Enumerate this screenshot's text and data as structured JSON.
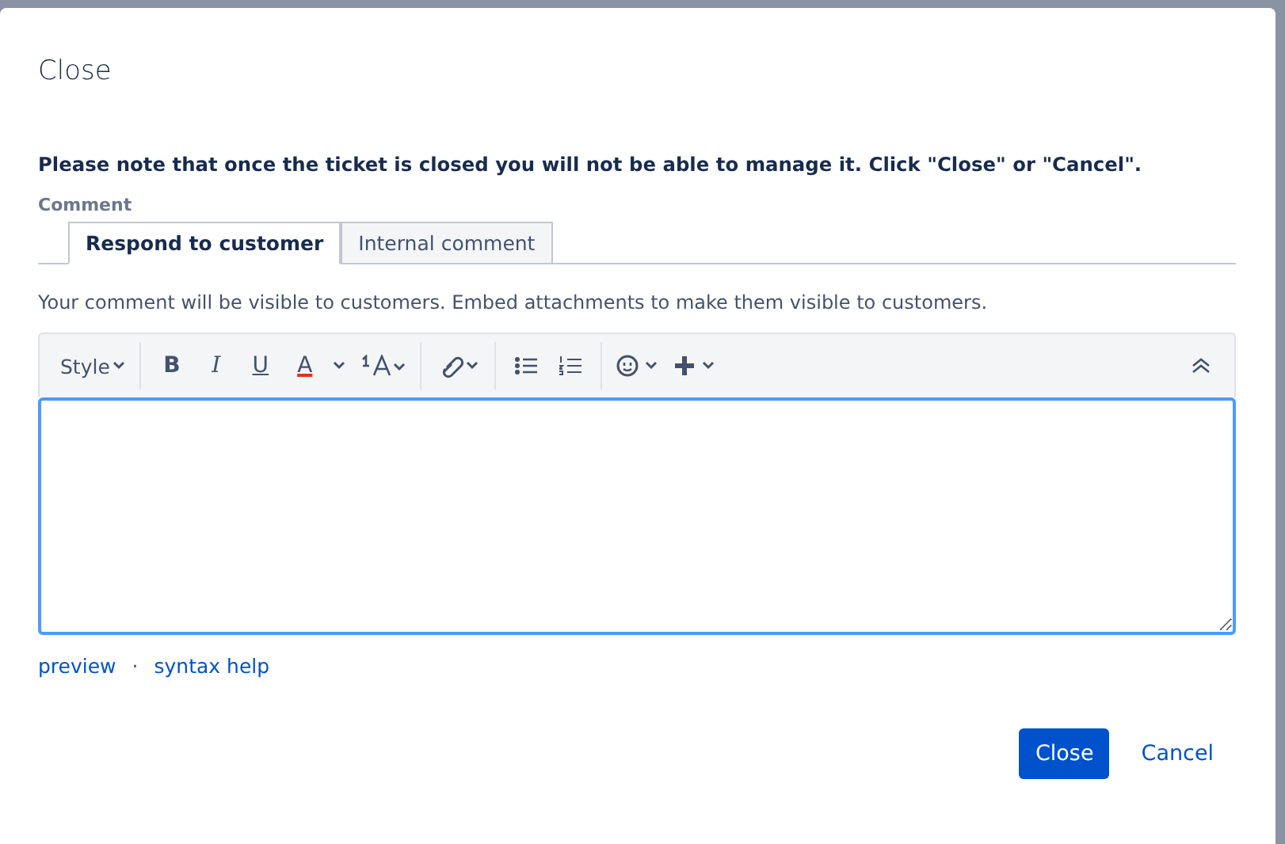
{
  "dialog": {
    "title": "Close",
    "notice": "Please note that once the ticket is closed you will not be able to manage it. Click \"Close\" or \"Cancel\".",
    "comment_label": "Comment",
    "tabs": [
      {
        "label": "Respond to customer",
        "selected": true
      },
      {
        "label": "Internal comment",
        "selected": false
      }
    ],
    "visibility_note": "Your comment will be visible to customers. Embed attachments to make them visible to customers.",
    "toolbar": [
      {
        "kind": "dropdown",
        "label": "Style"
      },
      {
        "kind": "sep"
      },
      {
        "kind": "bold",
        "label": "B"
      },
      {
        "kind": "italic",
        "label": "I"
      },
      {
        "kind": "underline",
        "label": "U"
      },
      {
        "kind": "textcolor",
        "label": "A"
      },
      {
        "kind": "caret"
      },
      {
        "kind": "textsize"
      },
      {
        "kind": "sep"
      },
      {
        "kind": "link"
      },
      {
        "kind": "sep"
      },
      {
        "kind": "bullets"
      },
      {
        "kind": "numbers"
      },
      {
        "kind": "sep"
      },
      {
        "kind": "emoji"
      },
      {
        "kind": "plus"
      },
      {
        "kind": "spacer"
      },
      {
        "kind": "collapse"
      }
    ],
    "links": [
      "preview",
      "syntax help"
    ],
    "link_separator": "·",
    "buttons": [
      {
        "label": "Close",
        "kind": "primary"
      },
      {
        "label": "Cancel",
        "kind": "link"
      }
    ]
  }
}
